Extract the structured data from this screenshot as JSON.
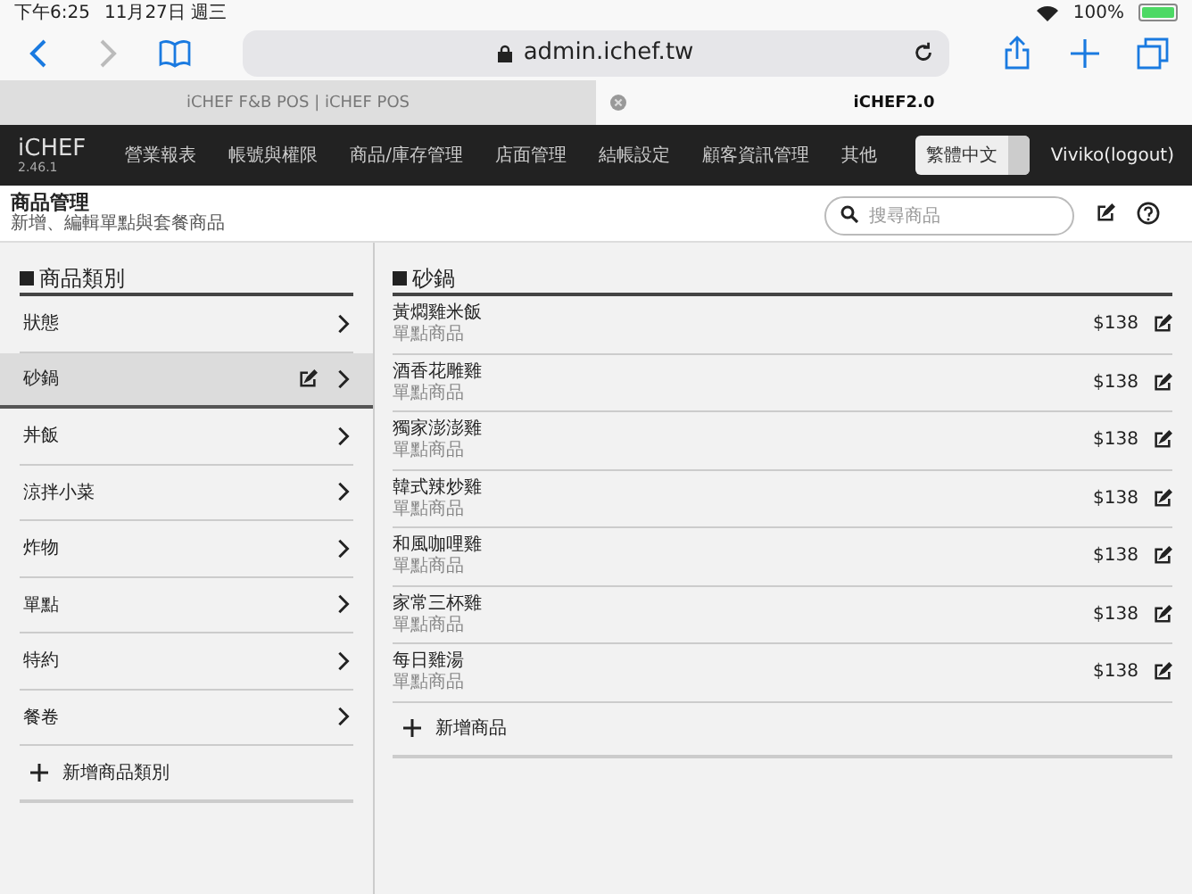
{
  "status_bar": {
    "time": "下午6:25",
    "date": "11月27日 週三",
    "battery": "100%"
  },
  "browser": {
    "url": "admin.ichef.tw",
    "tabs": [
      {
        "label": "iCHEF F&B POS | iCHEF POS",
        "selected": false
      },
      {
        "label": "iCHEF2.0",
        "selected": true
      }
    ]
  },
  "navbar": {
    "brand": "iCHEF",
    "version": "2.46.1",
    "items": [
      "營業報表",
      "帳號與權限",
      "商品/庫存管理",
      "店面管理",
      "結帳設定",
      "顧客資訊管理",
      "其他"
    ],
    "language": "繁體中文",
    "user": "Viviko(logout)"
  },
  "page_header": {
    "title": "商品管理",
    "subtitle": "新增、編輯單點與套餐商品",
    "search": {
      "placeholder": "搜尋商品"
    }
  },
  "categories": {
    "heading": "商品類別",
    "items": [
      {
        "label": "狀態",
        "selected": false
      },
      {
        "label": "砂鍋",
        "selected": true
      },
      {
        "label": "丼飯",
        "selected": false
      },
      {
        "label": "涼拌小菜",
        "selected": false
      },
      {
        "label": "炸物",
        "selected": false
      },
      {
        "label": "單點",
        "selected": false
      },
      {
        "label": "特約",
        "selected": false
      },
      {
        "label": "餐卷",
        "selected": false
      }
    ],
    "add_label": "新增商品類別"
  },
  "products": {
    "heading": "砂鍋",
    "items": [
      {
        "name": "黃燜雞米飯",
        "type": "單點商品",
        "price": "$138"
      },
      {
        "name": "酒香花雕雞",
        "type": "單點商品",
        "price": "$138"
      },
      {
        "name": "獨家澎澎雞",
        "type": "單點商品",
        "price": "$138"
      },
      {
        "name": "韓式辣炒雞",
        "type": "單點商品",
        "price": "$138"
      },
      {
        "name": "和風咖哩雞",
        "type": "單點商品",
        "price": "$138"
      },
      {
        "name": "家常三杯雞",
        "type": "單點商品",
        "price": "$138"
      },
      {
        "name": "每日雞湯",
        "type": "單點商品",
        "price": "$138"
      }
    ],
    "add_label": "新增商品"
  }
}
